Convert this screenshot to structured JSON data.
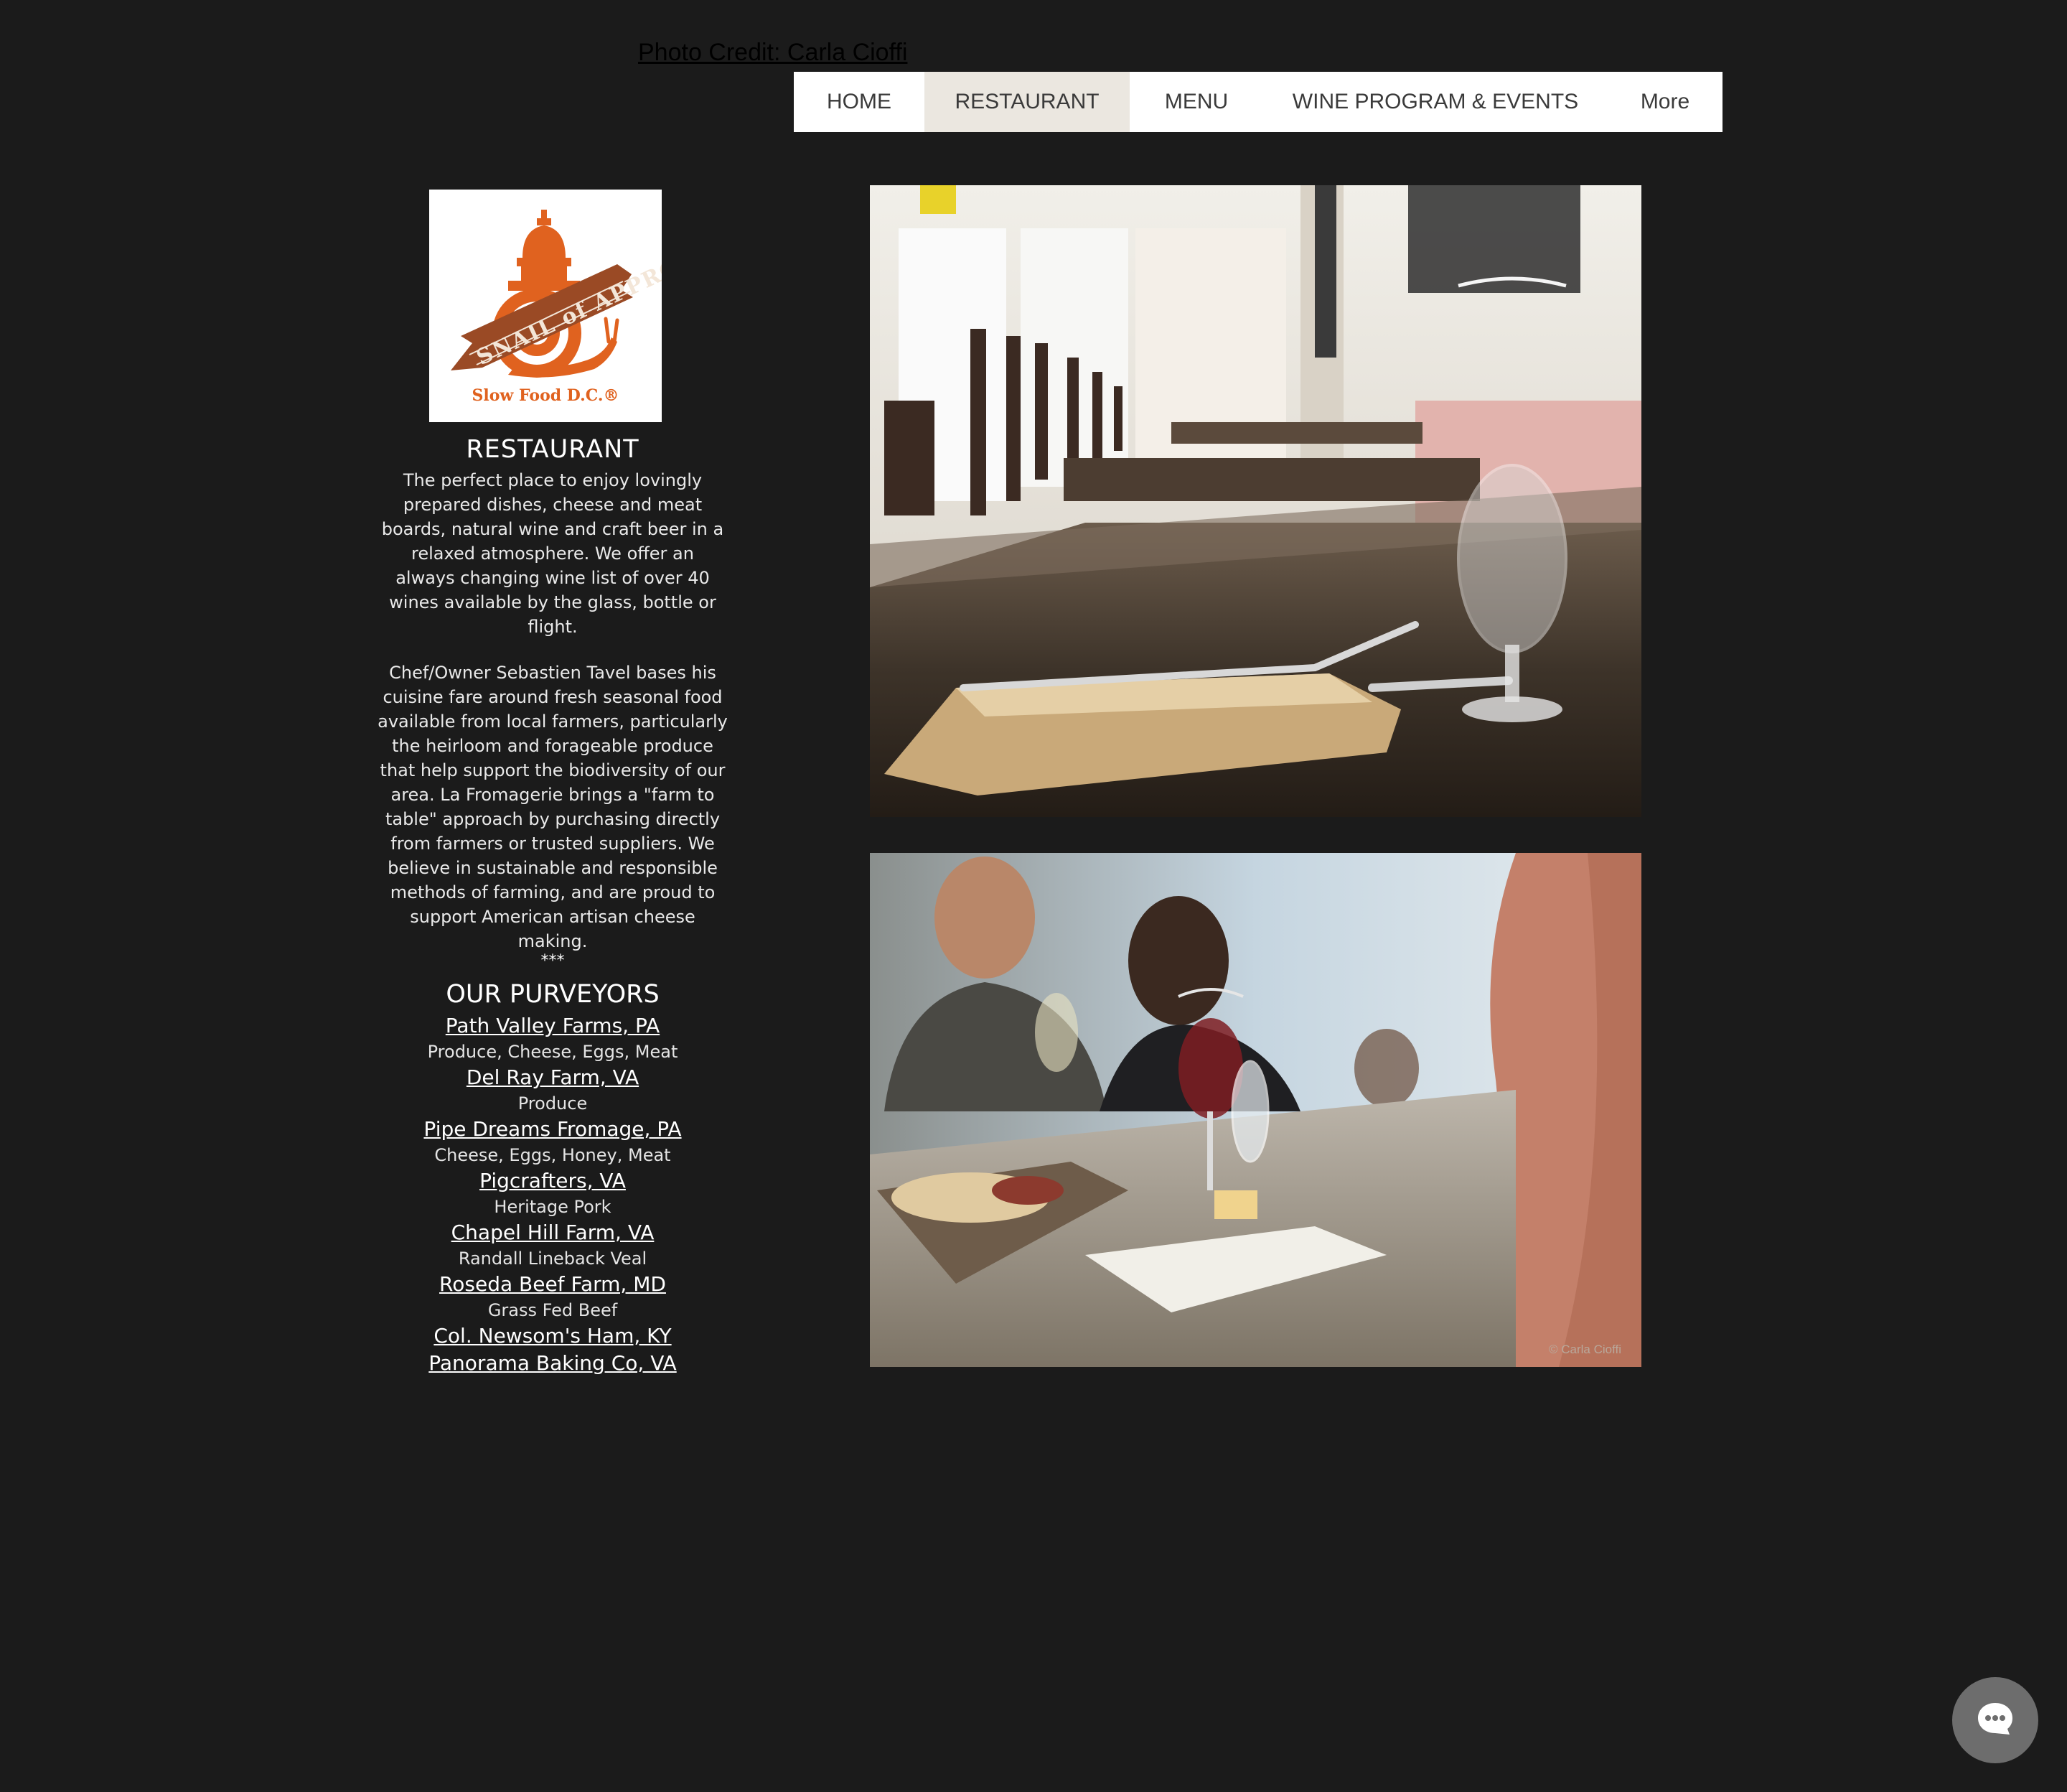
{
  "header": {
    "photo_credit": "Photo Credit: Carla Cioffi"
  },
  "nav": {
    "items": [
      {
        "label": "HOME",
        "active": false
      },
      {
        "label": "RESTAURANT",
        "active": true
      },
      {
        "label": "MENU",
        "active": false
      },
      {
        "label": "WINE PROGRAM & EVENTS",
        "active": false
      },
      {
        "label": "More",
        "active": false
      }
    ]
  },
  "logo": {
    "banner_text": "SNAIL of APPROVAL",
    "org": "Slow Food D.C.®"
  },
  "restaurant": {
    "title": "RESTAURANT",
    "intro": "The perfect place to enjoy lovingly prepared dishes, cheese and meat boards, natural wine and craft beer in a relaxed atmosphere.   We offer an always changing wine list of over 40 wines available by the glass, bottle or flight.",
    "about": "Chef/Owner Sebastien Tavel bases his cuisine fare around fresh seasonal food available from local farmers, particularly the heirloom and forageable produce that help support the biodiversity of our area.  La Fromagerie brings a \"farm to table\" approach by purchasing directly from farmers or  trusted suppliers. We believe in sustainable and responsible methods of farming, and are proud to support American artisan cheese making.",
    "separator": "***"
  },
  "purveyors": {
    "title": "OUR PURVEYORS",
    "items": [
      {
        "name": "Path Valley Farms, PA ",
        "desc": "Produce, Cheese, Eggs, Meat"
      },
      {
        "name": "Del Ray Farm, VA",
        "desc": "Produce"
      },
      {
        "name": "Pipe Dreams Fromage, PA",
        "desc": "Cheese, Eggs, Honey, Meat"
      },
      {
        "name": "Pigcrafters, VA",
        "desc": "Heritage Pork"
      },
      {
        "name": "Chapel Hill Farm, VA",
        "desc": "Randall Lineback Veal"
      },
      {
        "name": "Roseda Beef Farm, MD",
        "desc": "Grass Fed Beef"
      },
      {
        "name": "Col. Newsom's Ham, KY",
        "desc": ""
      },
      {
        "name": "Panorama Baking Co, VA",
        "desc": ""
      }
    ]
  },
  "photos": {
    "copyright": "© Carla Cioffi"
  },
  "colors": {
    "background": "#1b1b1b",
    "nav_bg": "#ffffff",
    "nav_active_bg": "#ebe7e0",
    "logo_orange": "#e0621f"
  },
  "icons": {
    "chat": "chat-bubble-icon"
  }
}
